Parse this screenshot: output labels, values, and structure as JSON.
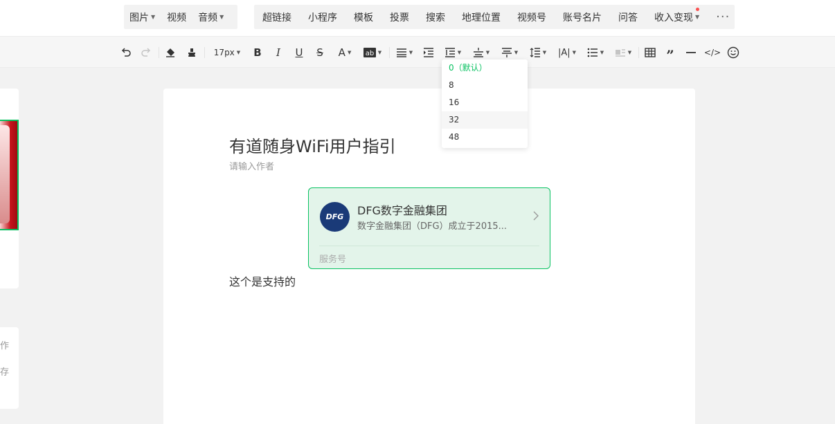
{
  "menu": {
    "media": [
      {
        "label": "图片",
        "caret": true
      },
      {
        "label": "视频",
        "caret": false
      },
      {
        "label": "音频",
        "caret": true
      }
    ],
    "insert": [
      {
        "label": "超链接"
      },
      {
        "label": "小程序"
      },
      {
        "label": "模板"
      },
      {
        "label": "投票"
      },
      {
        "label": "搜索"
      },
      {
        "label": "地理位置"
      },
      {
        "label": "视频号"
      },
      {
        "label": "账号名片"
      },
      {
        "label": "问答"
      },
      {
        "label": "收入变现",
        "caret": true,
        "badge": "red-dot"
      }
    ],
    "more_icon": "more-dots-icon"
  },
  "toolbar": {
    "font_size": "17px"
  },
  "editor": {
    "title": "有道随身WiFi用户指引",
    "author_placeholder": "请输入作者",
    "account_card": {
      "avatar_text": "DFG",
      "name": "DFG数字金融集团",
      "description": "数字金融集团（DFG）成立于2015...",
      "type": "服务号"
    },
    "body_text": "这个是支持的"
  },
  "spacing_dropdown": {
    "options": [
      "0（默认）",
      "8",
      "16",
      "32",
      "48"
    ],
    "selected_index": 0,
    "hover_index": 3
  },
  "side_panel": {
    "fragments": [
      "作",
      "存"
    ]
  },
  "colors": {
    "accent": "#07c160",
    "badge": "#fa5151",
    "card_bg": "#e3f4ea"
  }
}
